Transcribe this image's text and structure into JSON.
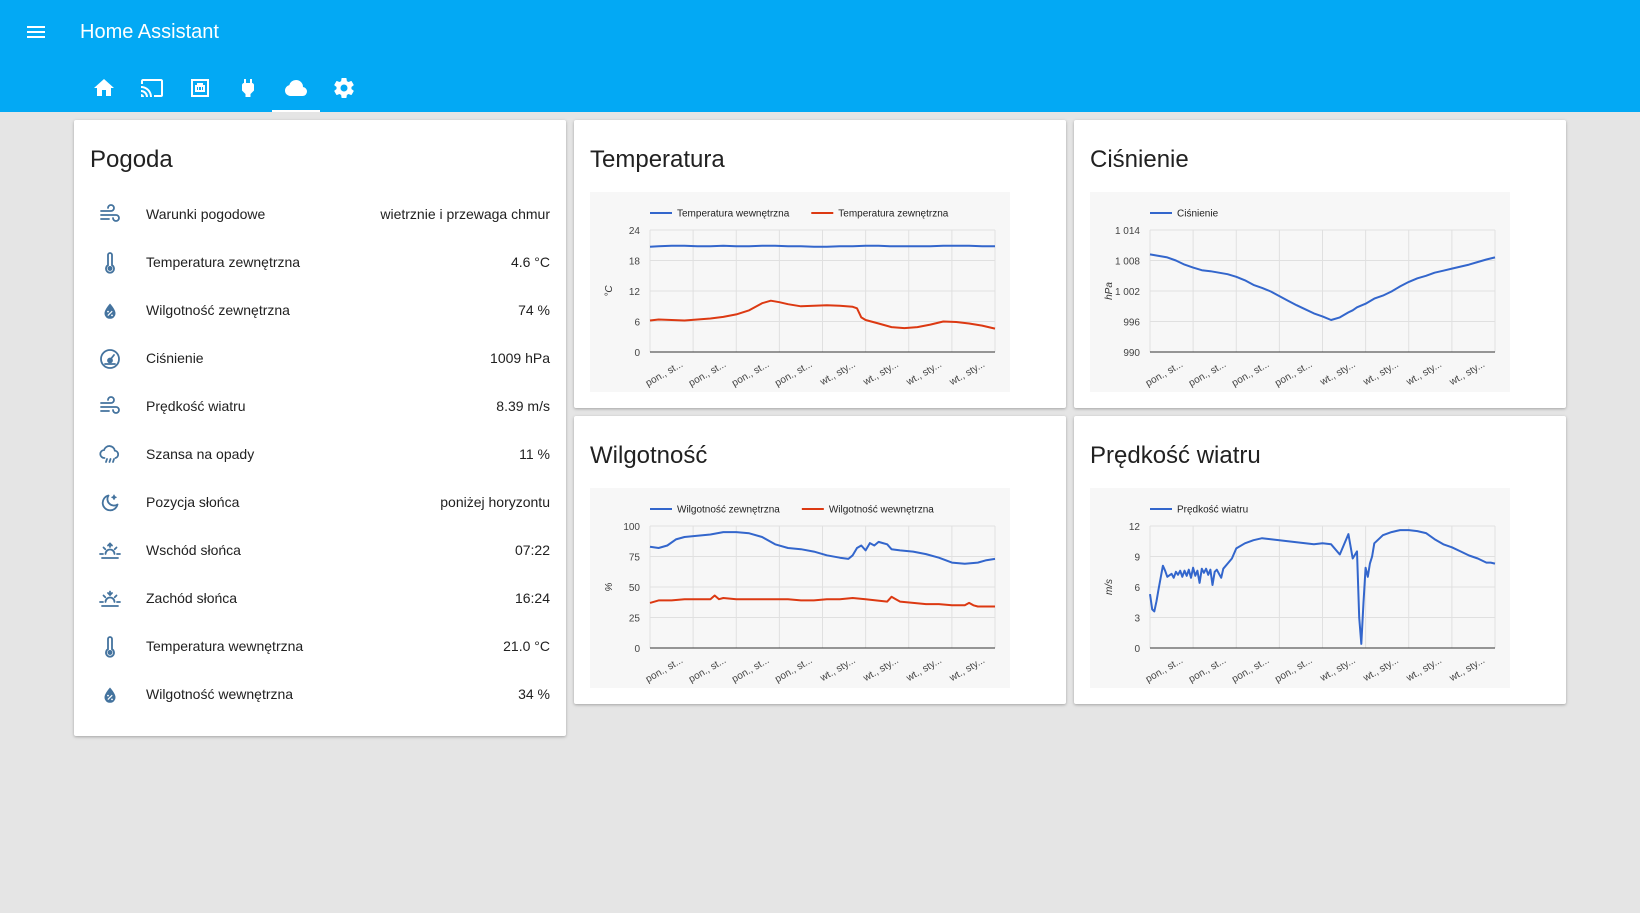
{
  "header": {
    "title": "Home Assistant",
    "tabs": [
      {
        "icon": "home-icon"
      },
      {
        "icon": "cast-icon"
      },
      {
        "icon": "ethernet-icon"
      },
      {
        "icon": "power-plug-icon"
      },
      {
        "icon": "cloud-icon",
        "active": true
      },
      {
        "icon": "settings-icon"
      }
    ]
  },
  "colors": {
    "header": "#03a9f4",
    "background": "#e5e5e5",
    "icon": "#44739e",
    "series_blue": "#3366cc",
    "series_red": "#dc3912"
  },
  "weather": {
    "title": "Pogoda",
    "rows": [
      {
        "icon": "weather-windy-icon",
        "label": "Warunki pogodowe",
        "value": "wietrznie i przewaga chmur"
      },
      {
        "icon": "thermometer-icon",
        "label": "Temperatura zewnętrzna",
        "value": "4.6 °C"
      },
      {
        "icon": "water-percent-icon",
        "label": "Wilgotność zewnętrzna",
        "value": "74 %"
      },
      {
        "icon": "gauge-icon",
        "label": "Ciśnienie",
        "value": "1009 hPa"
      },
      {
        "icon": "weather-windy-icon",
        "label": "Prędkość wiatru",
        "value": "8.39 m/s"
      },
      {
        "icon": "weather-rainy-icon",
        "label": "Szansa na opady",
        "value": "11 %"
      },
      {
        "icon": "weather-night-icon",
        "label": "Pozycja słońca",
        "value": "poniżej horyzontu"
      },
      {
        "icon": "weather-sunset-up-icon",
        "label": "Wschód słońca",
        "value": "07:22"
      },
      {
        "icon": "weather-sunset-down-icon",
        "label": "Zachód słońca",
        "value": "16:24"
      },
      {
        "icon": "thermometer-icon",
        "label": "Temperatura wewnętrzna",
        "value": "21.0 °C"
      },
      {
        "icon": "water-percent-icon",
        "label": "Wilgotność wewnętrzna",
        "value": "34 %"
      }
    ]
  },
  "chart_data": [
    {
      "id": "temp",
      "type": "line",
      "title": "Temperatura",
      "ylabel": "°C",
      "ylim": [
        0,
        24
      ],
      "yticks": [
        0,
        6,
        12,
        18,
        24
      ],
      "ytick_labels": [
        "0",
        "6",
        "12",
        "18",
        "24"
      ],
      "x_tick_labels": [
        "pon., st...",
        "pon., st...",
        "pon., st...",
        "pon., st...",
        "wt., sty...",
        "wt., sty...",
        "wt., sty...",
        "wt., sty..."
      ],
      "legend": "top",
      "grid": true,
      "series": [
        {
          "name": "Temperatura wewnętrzna",
          "color": "#3366cc",
          "x": [
            0,
            2,
            5,
            8,
            11,
            14,
            17,
            20,
            23,
            26,
            29,
            32,
            35,
            38,
            41,
            44,
            47,
            50,
            53,
            56,
            59,
            62,
            65,
            68,
            71,
            74,
            77,
            80
          ],
          "y": [
            20.7,
            20.8,
            20.9,
            20.9,
            20.8,
            20.8,
            20.9,
            20.8,
            20.8,
            20.9,
            20.9,
            20.8,
            20.8,
            20.7,
            20.7,
            20.8,
            20.8,
            20.9,
            20.9,
            20.8,
            20.8,
            20.8,
            20.8,
            20.9,
            20.9,
            20.9,
            20.8,
            20.8
          ]
        },
        {
          "name": "Temperatura zewnętrzna",
          "color": "#dc3912",
          "x": [
            0,
            2,
            5,
            8,
            11,
            14,
            17,
            20,
            23,
            26,
            28,
            30,
            32,
            35,
            38,
            41,
            44,
            47,
            48,
            49,
            50,
            53,
            56,
            59,
            62,
            65,
            68,
            71,
            74,
            77,
            80
          ],
          "y": [
            6.2,
            6.4,
            6.3,
            6.2,
            6.4,
            6.6,
            6.9,
            7.4,
            8.2,
            9.6,
            10.1,
            9.8,
            9.4,
            9.0,
            9.1,
            9.2,
            9.1,
            8.9,
            8.6,
            6.8,
            6.3,
            5.6,
            4.9,
            4.7,
            4.9,
            5.4,
            6.0,
            5.9,
            5.6,
            5.2,
            4.6
          ]
        }
      ]
    },
    {
      "id": "press",
      "type": "line",
      "title": "Ciśnienie",
      "ylabel": "hPa",
      "ylim": [
        990,
        1014
      ],
      "yticks": [
        990,
        996,
        1002,
        1008,
        1014
      ],
      "ytick_labels": [
        "990",
        "996",
        "1 002",
        "1 008",
        "1 014"
      ],
      "x_tick_labels": [
        "pon., st...",
        "pon., st...",
        "pon., st...",
        "pon., st...",
        "wt., sty...",
        "wt., sty...",
        "wt., sty...",
        "wt., sty..."
      ],
      "legend": "top",
      "grid": true,
      "series": [
        {
          "name": "Ciśnienie",
          "color": "#3366cc",
          "x": [
            0,
            2,
            4,
            6,
            8,
            10,
            12,
            14,
            16,
            18,
            20,
            22,
            24,
            26,
            28,
            30,
            32,
            34,
            36,
            38,
            40,
            42,
            44,
            46,
            47,
            48,
            50,
            52,
            54,
            56,
            58,
            60,
            62,
            64,
            66,
            68,
            70,
            72,
            74,
            76,
            78,
            80
          ],
          "y": [
            1009.2,
            1008.9,
            1008.6,
            1008.0,
            1007.2,
            1006.6,
            1006.1,
            1005.9,
            1005.6,
            1005.3,
            1004.8,
            1004.1,
            1003.2,
            1002.6,
            1001.9,
            1001.0,
            1000.1,
            999.2,
            998.4,
            997.6,
            997.0,
            996.3,
            996.8,
            997.8,
            998.2,
            998.8,
            999.5,
            1000.5,
            1001.1,
            1001.9,
            1002.9,
            1003.8,
            1004.5,
            1005.0,
            1005.6,
            1006.0,
            1006.4,
            1006.8,
            1007.2,
            1007.7,
            1008.2,
            1008.6
          ]
        }
      ]
    },
    {
      "id": "hum",
      "type": "line",
      "title": "Wilgotność",
      "ylabel": "%",
      "ylim": [
        0,
        100
      ],
      "yticks": [
        0,
        25,
        50,
        75,
        100
      ],
      "ytick_labels": [
        "0",
        "25",
        "50",
        "75",
        "100"
      ],
      "x_tick_labels": [
        "pon., st...",
        "pon., st...",
        "pon., st...",
        "pon., st...",
        "wt., sty...",
        "wt., sty...",
        "wt., sty...",
        "wt., sty..."
      ],
      "legend": "top",
      "grid": true,
      "series": [
        {
          "name": "Wilgotność zewnętrzna",
          "color": "#3366cc",
          "x": [
            0,
            2,
            4,
            6,
            8,
            11,
            14,
            17,
            20,
            23,
            26,
            29,
            32,
            35,
            38,
            41,
            44,
            46,
            47,
            48,
            49,
            50,
            51,
            52,
            53,
            54,
            55,
            56,
            58,
            61,
            64,
            67,
            70,
            73,
            76,
            78,
            80
          ],
          "y": [
            83,
            82,
            84,
            89,
            91,
            92,
            93,
            95,
            95,
            94,
            91,
            85,
            82,
            81,
            79,
            76,
            74,
            73,
            76,
            82,
            84,
            80,
            86,
            84,
            87,
            86,
            85,
            81,
            80,
            79,
            77,
            74,
            70,
            69,
            70,
            72,
            73
          ]
        },
        {
          "name": "Wilgotność wewnętrzna",
          "color": "#dc3912",
          "x": [
            0,
            2,
            5,
            8,
            11,
            14,
            15,
            16,
            17,
            20,
            23,
            26,
            29,
            32,
            35,
            38,
            41,
            44,
            47,
            50,
            55,
            56,
            57,
            58,
            61,
            64,
            67,
            70,
            73,
            74,
            75,
            76,
            78,
            80
          ],
          "y": [
            37,
            39,
            39,
            40,
            40,
            40,
            43,
            40,
            41,
            40,
            40,
            40,
            40,
            40,
            39,
            39,
            40,
            40,
            41,
            40,
            38,
            42,
            40,
            38,
            37,
            36,
            36,
            35,
            35,
            37,
            35,
            34,
            34,
            34
          ]
        }
      ]
    },
    {
      "id": "wind",
      "type": "line",
      "title": "Prędkość wiatru",
      "ylabel": "m/s",
      "ylim": [
        0,
        12
      ],
      "yticks": [
        0,
        3,
        6,
        9,
        12
      ],
      "ytick_labels": [
        "0",
        "3",
        "6",
        "9",
        "12"
      ],
      "x_tick_labels": [
        "pon., st...",
        "pon., st...",
        "pon., st...",
        "pon., st...",
        "wt., sty...",
        "wt., sty...",
        "wt., sty...",
        "wt., sty..."
      ],
      "legend": "top",
      "grid": true,
      "series": [
        {
          "name": "Prędkość wiatru",
          "color": "#3366cc",
          "x": [
            0,
            0.5,
            1,
            1.5,
            2,
            3,
            3.5,
            4,
            5,
            5.5,
            6,
            6.5,
            7,
            7.5,
            8,
            8.5,
            9,
            9.5,
            10,
            10.5,
            11,
            11.5,
            12,
            12.5,
            13,
            13.5,
            14,
            14.5,
            15,
            15.5,
            16,
            16.5,
            17,
            18,
            19,
            20,
            22,
            24,
            26,
            28,
            30,
            32,
            34,
            36,
            38,
            40,
            42,
            44,
            46,
            47,
            48,
            48.5,
            49,
            49.5,
            50,
            50.5,
            51,
            51.5,
            52,
            54,
            56,
            58,
            60,
            62,
            64,
            66,
            68,
            70,
            72,
            74,
            76,
            78,
            79,
            80
          ],
          "y": [
            5.3,
            3.8,
            3.6,
            4.6,
            5.8,
            8.1,
            7.6,
            7.0,
            7.3,
            6.9,
            7.5,
            7.2,
            7.6,
            7.0,
            7.6,
            7.1,
            7.7,
            6.9,
            7.9,
            7.1,
            7.6,
            6.4,
            7.8,
            7.4,
            7.8,
            7.2,
            7.7,
            6.2,
            7.5,
            7.7,
            7.3,
            6.9,
            7.8,
            8.3,
            8.8,
            9.8,
            10.3,
            10.6,
            10.8,
            10.7,
            10.6,
            10.5,
            10.4,
            10.3,
            10.2,
            10.3,
            10.2,
            9.2,
            11.2,
            8.8,
            9.5,
            3.0,
            0.4,
            4.5,
            7.9,
            7.0,
            8.3,
            9.0,
            10.3,
            11.1,
            11.4,
            11.6,
            11.6,
            11.5,
            11.3,
            10.7,
            10.2,
            9.9,
            9.5,
            9.1,
            8.8,
            8.4,
            8.4,
            8.3
          ]
        }
      ]
    }
  ]
}
